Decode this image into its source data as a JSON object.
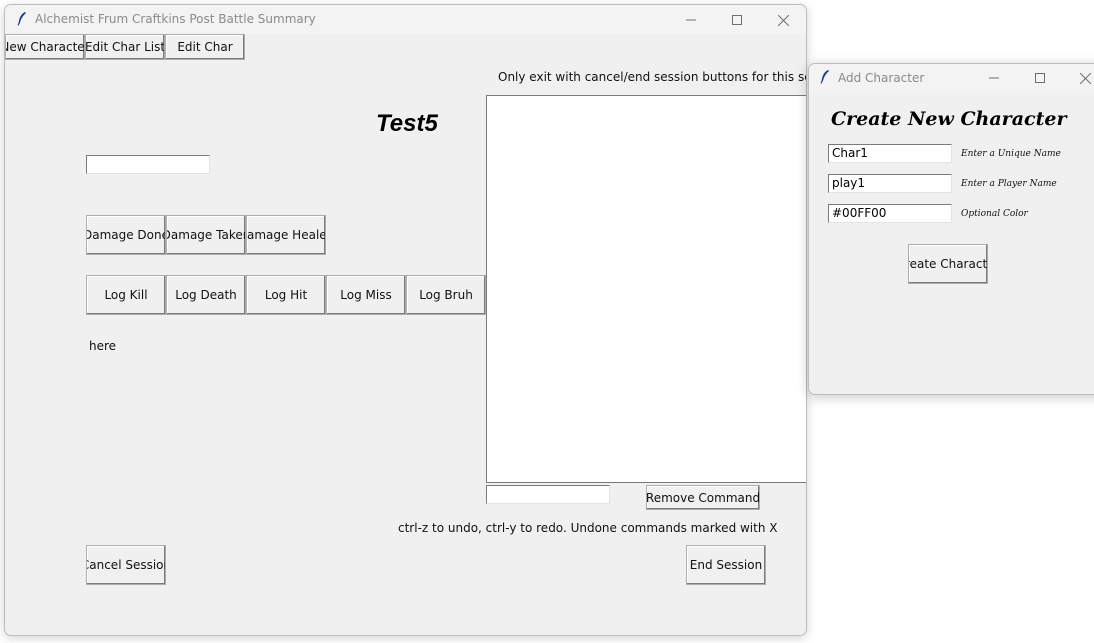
{
  "main_window": {
    "title": "Alchemist Frum Craftkins Post Battle Summary",
    "controls": {
      "minimize": "—",
      "maximize": "☐",
      "close": "✕"
    },
    "menu": {
      "new_character": "New Character",
      "edit_char_list": "Edit Char List",
      "edit_char": "Edit Char"
    },
    "exit_notice": "Only exit with cancel/end session buttons for this screne",
    "character_name": "Test5",
    "name_input_value": "",
    "damage_buttons": [
      "Damage Done",
      "Damage Taken",
      "Damage Healed"
    ],
    "log_buttons": [
      "Log Kill",
      "Log Death",
      "Log Hit",
      "Log Miss",
      "Log Bruh"
    ],
    "status_text": "here",
    "command_input_value": "",
    "remove_command": "Remove Command",
    "undo_hint": "ctrl-z to undo, ctrl-y to redo. Undone commands marked with X",
    "cancel_session": "Cancel Session",
    "end_session": "End Session"
  },
  "add_window": {
    "title": "Add Character",
    "heading": "Create New Character",
    "fields": [
      {
        "value": "Char1",
        "hint": "Enter a Unique Name"
      },
      {
        "value": "play1",
        "hint": "Enter a Player Name"
      },
      {
        "value": "#00FF00",
        "hint": "Optional Color"
      }
    ],
    "create_button": "Create Character"
  }
}
